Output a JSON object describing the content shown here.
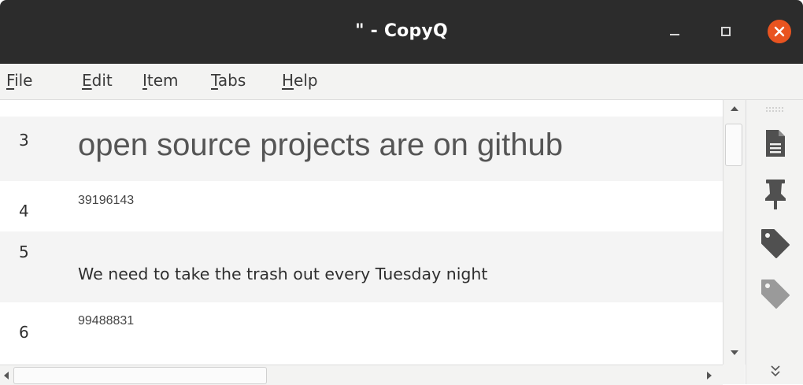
{
  "window": {
    "title": "\" - CopyQ",
    "controls": {
      "minimize_icon": "minimize-icon",
      "maximize_icon": "maximize-icon",
      "close_icon": "close-icon"
    },
    "close_color": "#e95420"
  },
  "menubar": {
    "items": [
      {
        "mnemonic": "F",
        "rest": "ile"
      },
      {
        "mnemonic": "E",
        "rest": "dit"
      },
      {
        "mnemonic": "I",
        "rest": "tem"
      },
      {
        "mnemonic": "T",
        "rest": "abs"
      },
      {
        "mnemonic": "H",
        "rest": "elp"
      }
    ]
  },
  "items": [
    {
      "number": "3",
      "text": "open source projects are on github"
    },
    {
      "number": "4",
      "text": "39196143"
    },
    {
      "number": "5",
      "text": "We need to take the trash out every Tuesday night"
    },
    {
      "number": "6",
      "text": "99488831"
    }
  ],
  "toolbar": {
    "tools": [
      "document-icon",
      "pin-icon",
      "tag-icon",
      "tag-outline-icon",
      "more-chevron-icon"
    ]
  }
}
